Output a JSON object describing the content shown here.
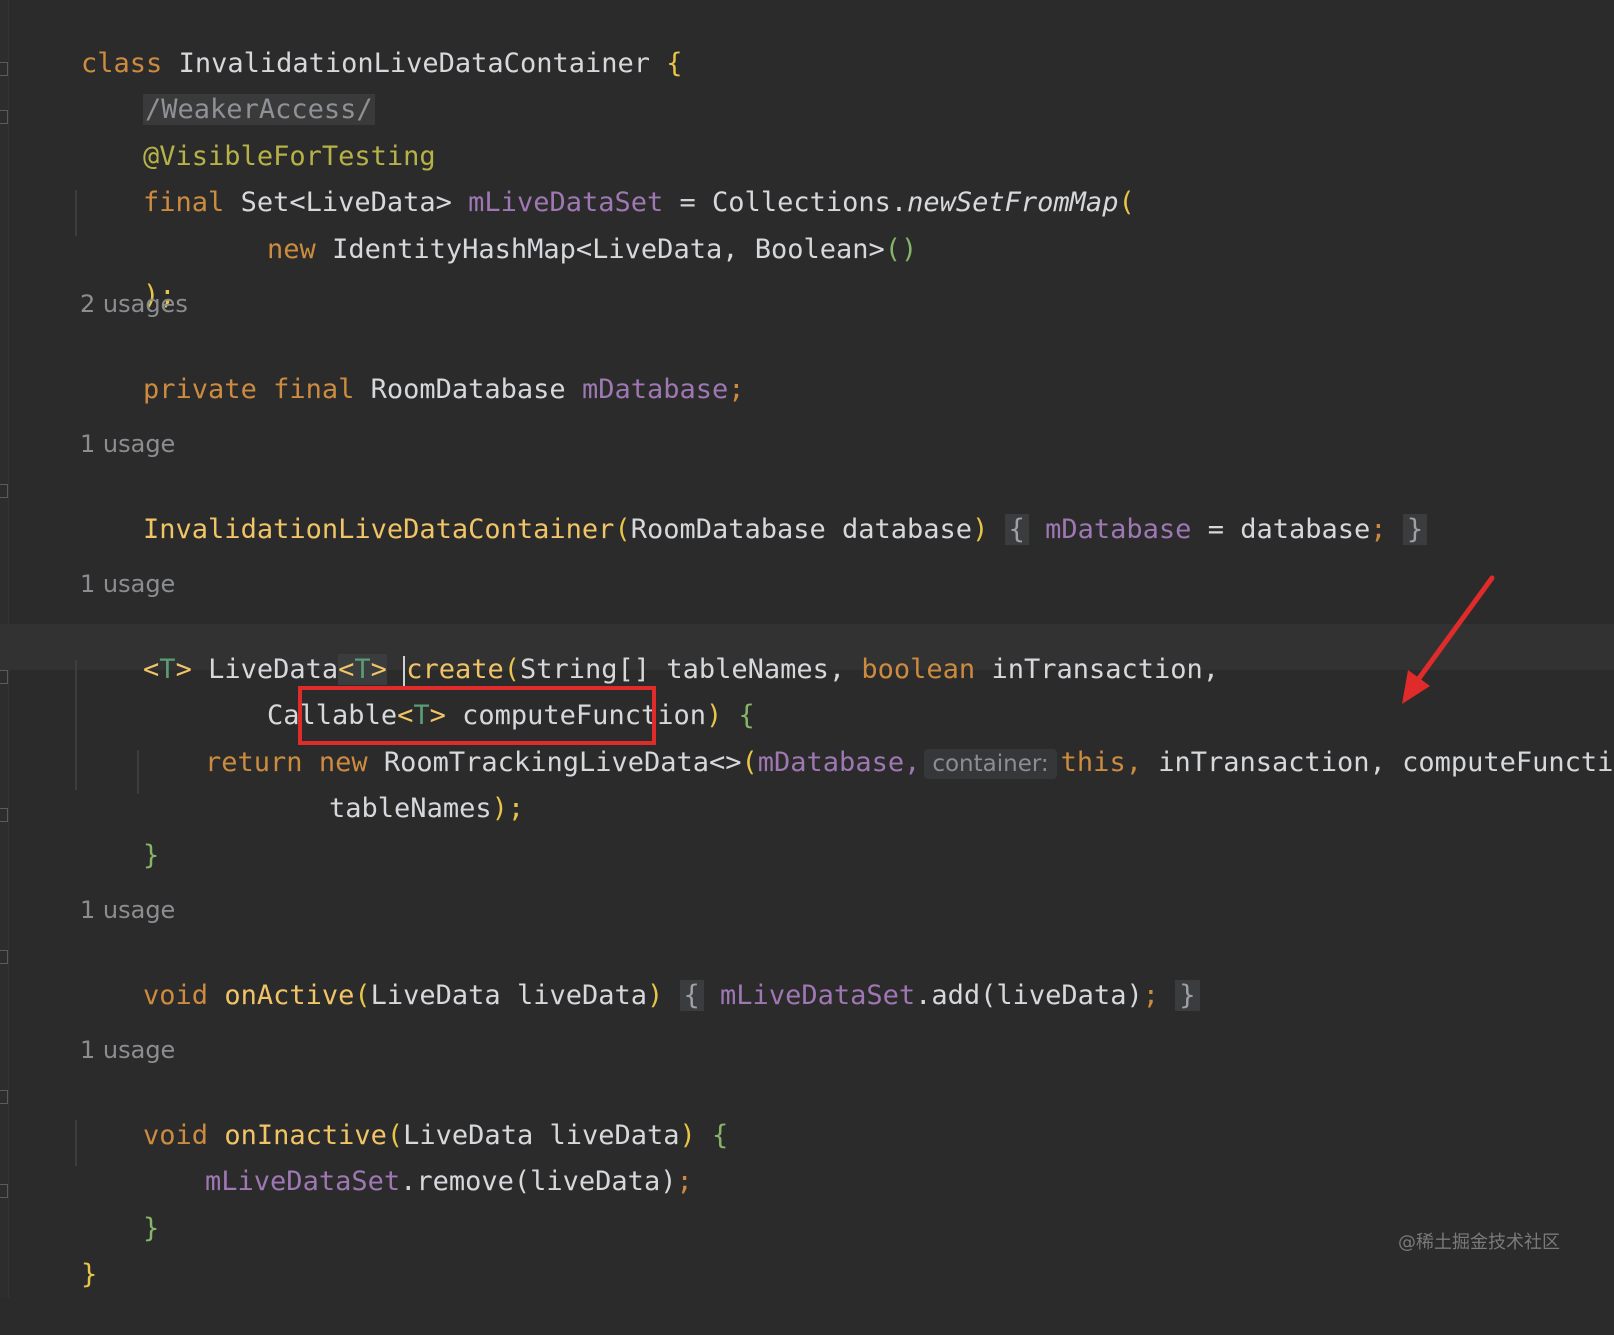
{
  "code": {
    "l1_class_kw": "class",
    "l1_class_name": "InvalidationLiveDataContainer",
    "l1_brace": "{",
    "l2_comment": "/WeakerAccess/",
    "l3_annotation": "@VisibleForTesting",
    "l4_final": "final",
    "l4_type": "Set<LiveData>",
    "l4_field": "mLiveDataSet",
    "l4_eq": "=",
    "l4_collections": "Collections.",
    "l4_method": "newSetFromMap",
    "l4_paren": "(",
    "l5_new": "new",
    "l5_type": "IdentityHashMap<LiveData, Boolean>",
    "l5_parens": "()",
    "l6_close": ");",
    "hint_2_usages": "2 usages",
    "l8_private": "private final",
    "l8_type": "RoomDatabase",
    "l8_field": "mDatabase",
    "l8_semi": ";",
    "hint_1_usage_a": "1 usage",
    "l10_ctor": "InvalidationLiveDataContainer",
    "l10_params": "RoomDatabase database",
    "l10_open": "{",
    "l10_field": "mDatabase",
    "l10_assign": "= database",
    "l10_semi": ";",
    "l10_close": "}",
    "hint_1_usage_b": "1 usage",
    "l12_gen_open": "<",
    "l12_gen_t": "T",
    "l12_gen_close": ">",
    "l12_livedata": "LiveData",
    "l12_create": "create",
    "l12_params": "String[] tableNames,",
    "l12_boolean": "boolean",
    "l12_intx": "inTransaction,",
    "l13_callable": "Callable",
    "l13_param": "computeFunction",
    "l13_brace": "{",
    "l14_return": "return",
    "l14_new": "new",
    "l14_type": "RoomTrackingLiveData<>",
    "l14_arg1": "mDatabase,",
    "l14_hint": "container:",
    "l14_this": "this,",
    "l14_intx": "inTransaction,",
    "l14_compute": "computeFunction,",
    "l15_tables": "tableNames",
    "l15_close": ");",
    "l16_brace": "}",
    "hint_1_usage_c": "1 usage",
    "l18_void": "void",
    "l18_name": "onActive",
    "l18_params": "LiveData liveData",
    "l18_open": "{",
    "l18_field": "mLiveDataSet",
    "l18_call": ".add(liveData)",
    "l18_semi": ";",
    "l18_close": "}",
    "hint_1_usage_d": "1 usage",
    "l20_void": "void",
    "l20_name": "onInactive",
    "l20_params": "LiveData liveData",
    "l20_brace": "{",
    "l21_field": "mLiveDataSet",
    "l21_call": ".remove(liveData)",
    "l21_semi": ";",
    "l22_brace": "}",
    "l23_brace": "}"
  },
  "watermark": "@稀土掘金技术社区",
  "colors": {
    "keyword": "#cc8b3f",
    "field": "#9e77b3",
    "function": "#f1c466",
    "annotation": "#b7b247",
    "highlight_box": "#e02b2b"
  }
}
